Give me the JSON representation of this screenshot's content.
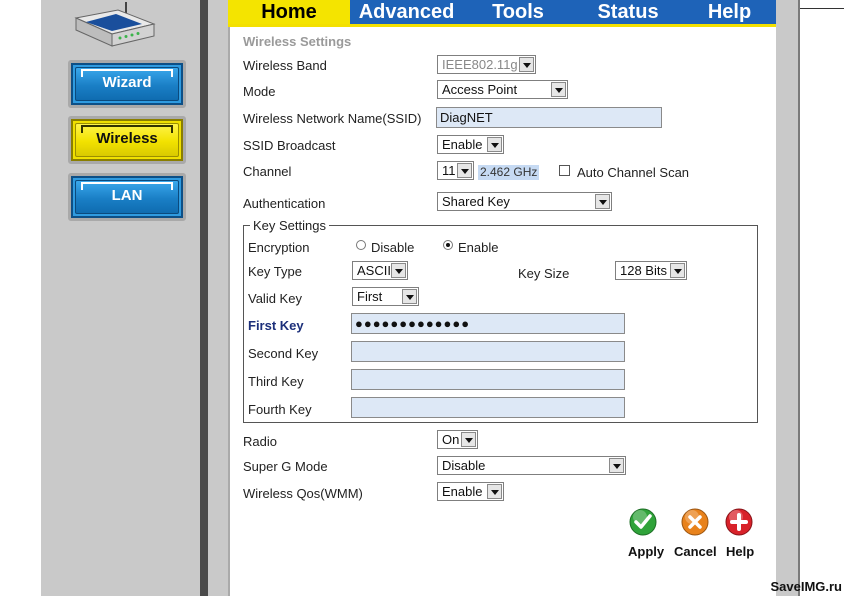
{
  "tabs": [
    {
      "label": "Home",
      "active": true
    },
    {
      "label": "Advanced",
      "active": false
    },
    {
      "label": "Tools",
      "active": false
    },
    {
      "label": "Status",
      "active": false
    },
    {
      "label": "Help",
      "active": false
    }
  ],
  "sidebar": {
    "items": [
      {
        "label": "Wizard",
        "active": false
      },
      {
        "label": "Wireless",
        "active": true
      },
      {
        "label": "LAN",
        "active": false
      }
    ]
  },
  "form": {
    "section_title": "Wireless Settings",
    "wireless_band": {
      "label": "Wireless Band",
      "value": "IEEE802.11g"
    },
    "mode": {
      "label": "Mode",
      "value": "Access Point"
    },
    "ssid": {
      "label": "Wireless Network Name(SSID)",
      "value": "DiagNET"
    },
    "ssid_broadcast": {
      "label": "SSID Broadcast",
      "value": "Enable"
    },
    "channel": {
      "label": "Channel",
      "value": "11",
      "frequency": "2.462 GHz",
      "auto_scan_label": "Auto Channel Scan",
      "auto_scan_checked": false
    },
    "authentication": {
      "label": "Authentication",
      "value": "Shared Key"
    },
    "key_settings": {
      "legend": "Key Settings",
      "encryption": {
        "label": "Encryption",
        "disable_label": "Disable",
        "enable_label": "Enable",
        "selected": "Enable"
      },
      "key_type": {
        "label": "Key Type",
        "value": "ASCII"
      },
      "key_size": {
        "label": "Key Size",
        "value": "128 Bits"
      },
      "valid_key": {
        "label": "Valid Key",
        "value": "First"
      },
      "first_key": {
        "label": "First Key",
        "value": "●●●●●●●●●●●●●"
      },
      "second_key": {
        "label": "Second Key",
        "value": ""
      },
      "third_key": {
        "label": "Third Key",
        "value": ""
      },
      "fourth_key": {
        "label": "Fourth Key",
        "value": ""
      }
    },
    "radio": {
      "label": "Radio",
      "value": "On"
    },
    "super_g": {
      "label": "Super G Mode",
      "value": "Disable"
    },
    "qos": {
      "label": "Wireless Qos(WMM)",
      "value": "Enable"
    }
  },
  "actions": {
    "apply": {
      "label": "Apply",
      "icon": "check-icon",
      "color": "#2fa33a"
    },
    "cancel": {
      "label": "Cancel",
      "icon": "x-icon",
      "color": "#e8821c"
    },
    "help": {
      "label": "Help",
      "icon": "plus-icon",
      "color": "#d8222a"
    }
  },
  "watermark": "SaveIMG.ru",
  "colors": {
    "tab_bar": "#1e63b8",
    "tab_active": "#f4e400",
    "sidebar_button": "#1a7fc6",
    "sidebar_active": "#f2e200"
  }
}
